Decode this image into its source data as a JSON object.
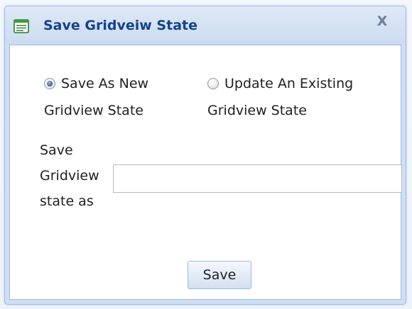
{
  "dialog": {
    "title": "Save Gridveiw State",
    "title_icon": "form-window-icon",
    "close_label": "X"
  },
  "options": [
    {
      "line1": "Save As New",
      "line2": "Gridview State",
      "checked": true
    },
    {
      "line1": "Update An Existing",
      "line2": "Gridview State",
      "checked": false
    }
  ],
  "name_field": {
    "label_lines": [
      "Save",
      "Gridview",
      "state as"
    ],
    "value": ""
  },
  "save_button": {
    "label": "Save"
  },
  "colors": {
    "title_text": "#15428b",
    "border": "#99bbe8",
    "frame": "#cfdff3"
  }
}
